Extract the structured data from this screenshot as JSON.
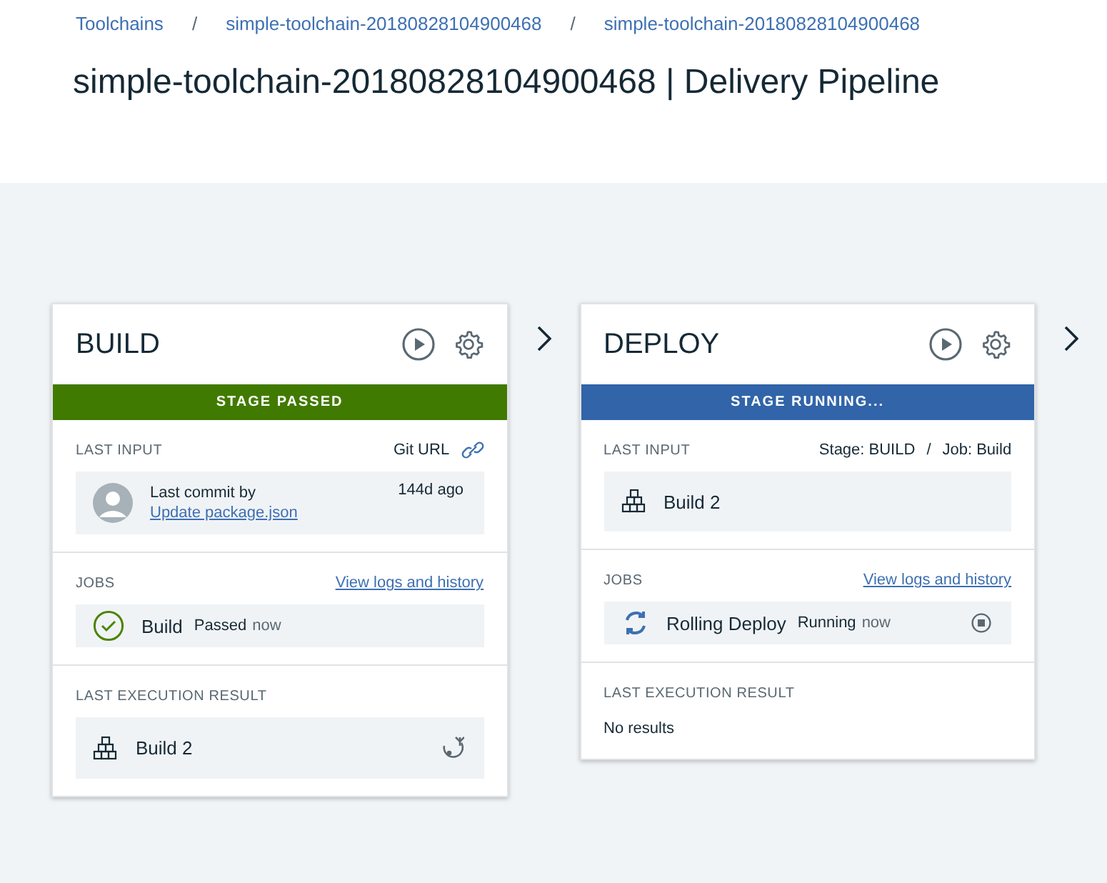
{
  "breadcrumb": [
    {
      "kind": "link",
      "text": "Toolchains"
    },
    {
      "kind": "separator",
      "text": "/"
    },
    {
      "kind": "link",
      "text": "simple-toolchain-20180828104900468"
    },
    {
      "kind": "separator",
      "text": "/"
    },
    {
      "kind": "link",
      "text": "simple-toolchain-20180828104900468"
    }
  ],
  "title": "simple-toolchain-20180828104900468 | Delivery Pipeline",
  "stages": [
    {
      "name": "BUILD",
      "status": {
        "kind": "passed",
        "label": "STAGE PASSED"
      },
      "last_input": {
        "label": "LAST INPUT",
        "kind": "commit",
        "source": [
          "Git URL"
        ],
        "commit_label": "Last commit by",
        "commit_message": "Update package.json",
        "age": "144d ago"
      },
      "jobs": {
        "label": "JOBS",
        "link": "View logs and history",
        "items": [
          {
            "name": "Build",
            "kind": "passed",
            "status": "Passed",
            "time": "now"
          }
        ]
      },
      "last_execution": {
        "label": "LAST EXECUTION RESULT",
        "kind": "build",
        "text": "Build 2"
      }
    },
    {
      "name": "DEPLOY",
      "status": {
        "kind": "running",
        "label": "STAGE RUNNING..."
      },
      "last_input": {
        "label": "LAST INPUT",
        "kind": "build",
        "source": [
          "Stage: BUILD",
          "/",
          "Job: Build"
        ],
        "build": "Build 2"
      },
      "jobs": {
        "label": "JOBS",
        "link": "View logs and history",
        "items": [
          {
            "name": "Rolling Deploy",
            "kind": "running",
            "status": "Running",
            "time": "now"
          }
        ]
      },
      "last_execution": {
        "label": "LAST EXECUTION RESULT",
        "kind": "empty",
        "text": "No results"
      }
    }
  ]
}
